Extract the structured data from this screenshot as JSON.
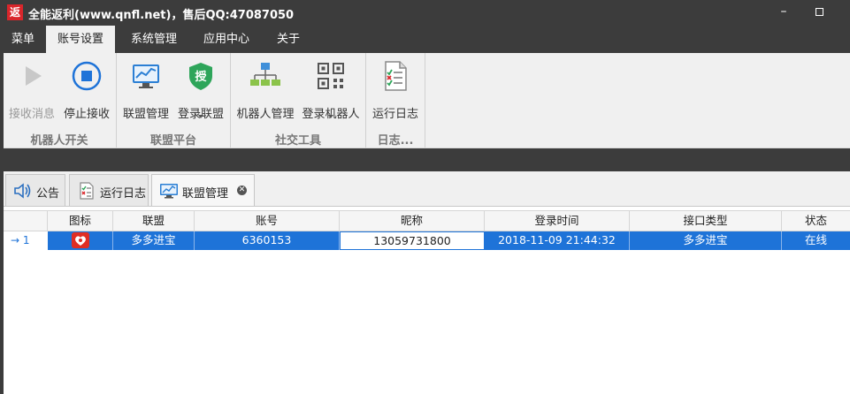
{
  "window": {
    "app_icon_glyph": "返",
    "title": "全能返利(www.qnfl.net)，售后QQ:47087050",
    "minimize_glyph": "–"
  },
  "menu": {
    "items": [
      {
        "label": "菜单"
      },
      {
        "label": "账号设置"
      },
      {
        "label": "系统管理"
      },
      {
        "label": "应用中心"
      },
      {
        "label": "关于"
      }
    ],
    "active_index": 1
  },
  "ribbon": {
    "groups": [
      {
        "label": "机器人开关",
        "buttons": [
          {
            "label": "接收消息",
            "icon": "play-icon",
            "enabled": false
          },
          {
            "label": "停止接收",
            "icon": "stop-icon",
            "enabled": true
          }
        ]
      },
      {
        "label": "联盟平台",
        "buttons": [
          {
            "label": "联盟管理",
            "icon": "chart-monitor-icon",
            "enabled": true
          },
          {
            "label": "登录联盟",
            "icon": "shield-authorize-icon",
            "enabled": true,
            "dropdown": true
          }
        ]
      },
      {
        "label": "社交工具",
        "buttons": [
          {
            "label": "机器人管理",
            "icon": "network-hierarchy-icon",
            "enabled": true
          },
          {
            "label": "登录机器人",
            "icon": "qr-code-icon",
            "enabled": true,
            "dropdown": true
          }
        ]
      },
      {
        "label": "日志...",
        "buttons": [
          {
            "label": "运行日志",
            "icon": "log-document-icon",
            "enabled": true
          }
        ]
      }
    ],
    "shield_glyph": "授"
  },
  "tabs": [
    {
      "label": "公告",
      "icon": "speaker-icon",
      "active": false
    },
    {
      "label": "运行日志",
      "icon": "log-document-icon",
      "active": false
    },
    {
      "label": "联盟管理",
      "icon": "chart-monitor-icon",
      "active": true,
      "closable": true
    }
  ],
  "tab_close_glyph": "✕",
  "grid": {
    "columns": [
      "图标",
      "联盟",
      "账号",
      "昵称",
      "登录时间",
      "接口类型",
      "状态"
    ],
    "rows": [
      {
        "indicator": "→ 1",
        "icon": "pinduoduo-logo-icon",
        "alliance": "多多进宝",
        "account": "6360153",
        "nickname": "13059731800",
        "login_time": "2018-11-09 21:44:32",
        "interface_type": "多多进宝",
        "status": "在线"
      }
    ]
  },
  "colors": {
    "chrome_dark": "#3c3c3c",
    "selection_blue": "#1e73d8",
    "brand_red": "#d9262b"
  }
}
